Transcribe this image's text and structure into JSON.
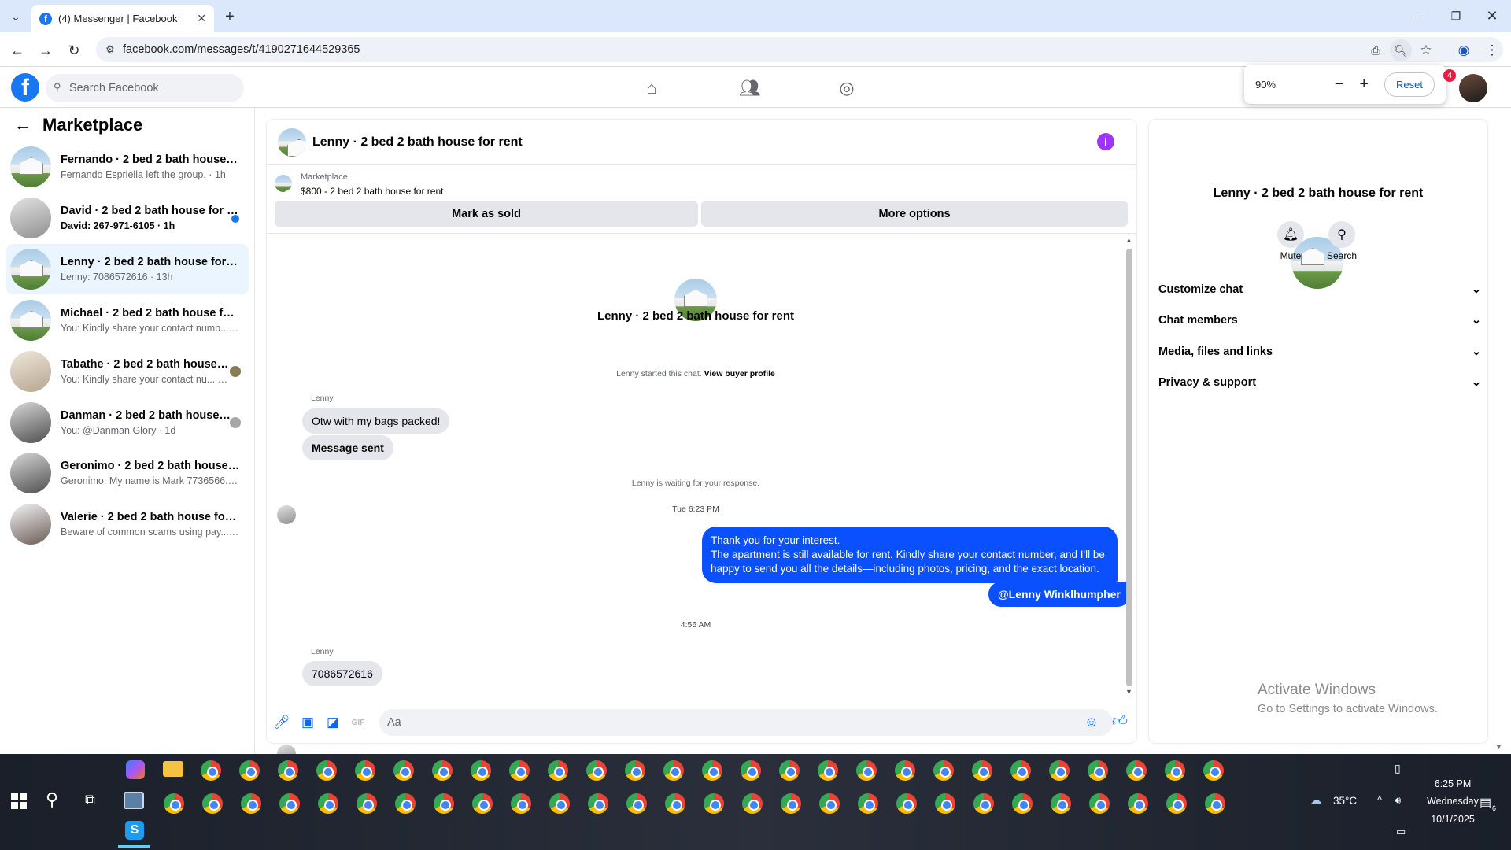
{
  "browser": {
    "tab_title": "(4) Messenger | Facebook",
    "url": "facebook.com/messages/t/4190271644529365",
    "zoom_level": "90%",
    "zoom_reset": "Reset"
  },
  "fb": {
    "search_placeholder": "Search Facebook",
    "notif_count": "4"
  },
  "sidebar": {
    "title": "Marketplace",
    "conversations": [
      {
        "title": "Fernando · 2 bed 2 bath house for ...",
        "subtitle": "Fernando Espriella left the group. · 1h"
      },
      {
        "title": "David · 2 bed 2 bath house for re...",
        "subtitle": "David: 267-971-6105 · 1h"
      },
      {
        "title": "Lenny · 2 bed 2 bath house for rent",
        "subtitle": "Lenny: 7086572616 · 13h"
      },
      {
        "title": "Michael · 2 bed 2 bath house for r...",
        "subtitle": "You: Kindly share your contact numb... · 23h"
      },
      {
        "title": "Tabathe · 2 bed 2 bath house fo...",
        "subtitle": "You: Kindly share your contact nu... · 23h"
      },
      {
        "title": "Danman · 2 bed 2 bath house fo...",
        "subtitle": "You: @Danman Glory · 1d"
      },
      {
        "title": "Geronimo · 2 bed 2 bath house for...",
        "subtitle": "Geronimo: My name is Mark 7736566... · 1d"
      },
      {
        "title": "Valerie · 2 bed 2 bath house for rent",
        "subtitle": "Beware of common scams using pay... · 1d"
      }
    ]
  },
  "chat": {
    "header_title": "Lenny · 2 bed 2 bath house for rent",
    "mp_label": "Marketplace",
    "mp_listing": "$800 - 2 bed 2 bath house for rent",
    "mark_sold": "Mark as sold",
    "more_options": "More options",
    "intro_title": "Lenny · 2 bed 2 bath house for rent",
    "started_text": "Lenny started this chat.",
    "view_profile": "View buyer profile",
    "sender1": "Lenny",
    "msg1": "Otw with my bags packed!",
    "msg2": "Message sent",
    "waiting": "Lenny is waiting for your response.",
    "time1": "Tue 6:23 PM",
    "my_msg_line1": "Thank you for your interest.",
    "my_msg_line2": "The apartment is still available for rent. Kindly share your contact number, and I'll be",
    "my_msg_line3": "happy to send you all the details—including photos, pricing, and the exact location.",
    "mention": "@Lenny Winklhumpher",
    "time2": "4:56 AM",
    "sender2": "Lenny",
    "msg3": "7086572616",
    "compose_placeholder": "Aa"
  },
  "details": {
    "title": "Lenny · 2 bed 2 bath house for rent",
    "mute": "Mute",
    "search": "Search",
    "sections": [
      "Customize chat",
      "Chat members",
      "Media, files and links",
      "Privacy & support"
    ],
    "watermark1": "Activate Windows",
    "watermark2": "Go to Settings to activate Windows."
  },
  "taskbar": {
    "temp": "35°C",
    "time": "6:25 PM",
    "day": "Wednesday",
    "date": "10/1/2025",
    "notif": "6"
  },
  "colors": {
    "brand": "#1877f2",
    "my_bubble": "#0a50ff",
    "info": "#a033ff"
  }
}
